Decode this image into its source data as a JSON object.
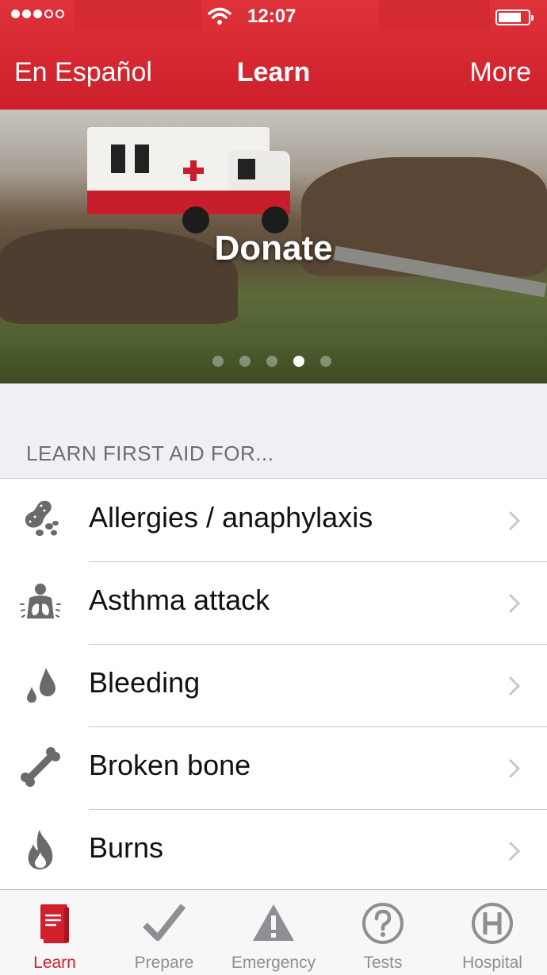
{
  "status_bar": {
    "time": "12:07",
    "signal_bars_filled": 3,
    "signal_bars_total": 5
  },
  "nav": {
    "left_label": "En Español",
    "title": "Learn",
    "right_label": "More"
  },
  "hero": {
    "title": "Donate",
    "page_count": 5,
    "active_page": 4
  },
  "section": {
    "header": "LEARN FIRST AID FOR..."
  },
  "list": {
    "items": [
      {
        "label": "Allergies / anaphylaxis",
        "icon": "peanut-icon"
      },
      {
        "label": "Asthma attack",
        "icon": "lungs-icon"
      },
      {
        "label": "Bleeding",
        "icon": "blood-drop-icon"
      },
      {
        "label": "Broken bone",
        "icon": "bone-icon"
      },
      {
        "label": "Burns",
        "icon": "flame-icon"
      }
    ]
  },
  "tabbar": {
    "tabs": [
      {
        "label": "Learn",
        "icon": "book-icon",
        "active": true
      },
      {
        "label": "Prepare",
        "icon": "checkmark-icon",
        "active": false
      },
      {
        "label": "Emergency",
        "icon": "warning-icon",
        "active": false
      },
      {
        "label": "Tests",
        "icon": "question-icon",
        "active": false
      },
      {
        "label": "Hospital",
        "icon": "hospital-icon",
        "active": false
      }
    ]
  },
  "colors": {
    "brand_red": "#d21f2c",
    "header_red": "#e0323a",
    "inactive_gray": "#8e8e93",
    "icon_gray": "#6a6a6a"
  }
}
